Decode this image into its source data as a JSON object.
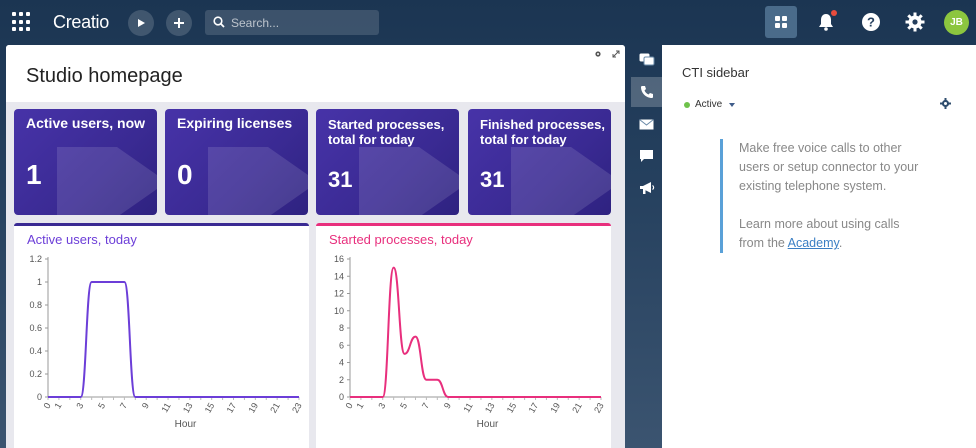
{
  "topbar": {
    "logo": "Creatio",
    "search_placeholder": "Search...",
    "avatar_initials": "JB"
  },
  "page": {
    "title": "Studio homepage"
  },
  "tiles": [
    {
      "caption": "Active users, now",
      "value": "1"
    },
    {
      "caption": "Expiring licenses",
      "value": "0"
    },
    {
      "caption": "Started processes, total for today",
      "value": "31"
    },
    {
      "caption": "Finished processes, total for today",
      "value": "31"
    }
  ],
  "charts": [
    {
      "title": "Active users, today",
      "color": "#6c3ed8"
    },
    {
      "title": "Started processes, today",
      "color": "#e82f7d"
    }
  ],
  "chart_data": [
    {
      "type": "line",
      "title": "Active users, today",
      "xlabel": "Hour",
      "ylabel": "",
      "ylim": [
        0,
        1.2
      ],
      "yticks": [
        "0",
        "0.2",
        "0.4",
        "0.6",
        "0.8",
        "1",
        "1.2"
      ],
      "xticks": [
        "0",
        "1",
        "3",
        "5",
        "7",
        "9",
        "11",
        "13",
        "15",
        "17",
        "19",
        "21",
        "23"
      ],
      "series": [
        {
          "x": [
            0,
            1,
            2,
            3,
            4,
            5,
            6,
            7,
            8,
            9,
            10,
            11,
            12,
            13,
            14,
            15,
            16,
            17,
            18,
            19,
            20,
            21,
            22,
            23
          ],
          "values": [
            0,
            0,
            0,
            0,
            1,
            1,
            1,
            1,
            0,
            0,
            0,
            0,
            0,
            0,
            0,
            0,
            0,
            0,
            0,
            0,
            0,
            0,
            0,
            0
          ]
        }
      ]
    },
    {
      "type": "line",
      "title": "Started processes, today",
      "xlabel": "Hour",
      "ylabel": "",
      "ylim": [
        0,
        16
      ],
      "yticks": [
        "0",
        "2",
        "4",
        "6",
        "8",
        "10",
        "12",
        "14",
        "16"
      ],
      "xticks": [
        "0",
        "1",
        "3",
        "5",
        "7",
        "9",
        "11",
        "13",
        "15",
        "17",
        "19",
        "21",
        "23"
      ],
      "series": [
        {
          "x": [
            0,
            1,
            2,
            3,
            4,
            5,
            6,
            7,
            8,
            9,
            10,
            11,
            12,
            13,
            14,
            15,
            16,
            17,
            18,
            19,
            20,
            21,
            22,
            23
          ],
          "values": [
            0,
            0,
            0,
            0,
            15,
            5,
            7,
            2,
            2,
            0,
            0,
            0,
            0,
            0,
            0,
            0,
            0,
            0,
            0,
            0,
            0,
            0,
            0,
            0
          ]
        }
      ]
    }
  ],
  "cti": {
    "title": "CTI sidebar",
    "status": "Active",
    "info_line1": "Make free voice calls to other users or setup connector to your existing telephone system.",
    "info_line2_prefix": "Learn more about using calls from the ",
    "academy_link": "Academy",
    "info_line2_suffix": "."
  }
}
